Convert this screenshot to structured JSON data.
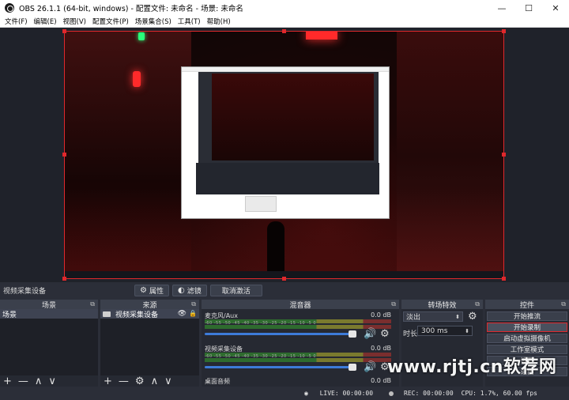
{
  "window": {
    "title": "OBS 26.1.1 (64-bit, windows) - 配置文件: 未命名 - 场景: 未命名",
    "minimize": "—",
    "maximize": "☐",
    "close": "✕"
  },
  "menu": [
    "文件(F)",
    "编辑(E)",
    "视图(V)",
    "配置文件(P)",
    "场景集合(S)",
    "工具(T)",
    "帮助(H)"
  ],
  "statusrow": {
    "source_name": "视频采集设备",
    "properties_label": "属性",
    "filters_label": "滤镜",
    "deactivate_label": "取消激活"
  },
  "scenes": {
    "header": "场景",
    "items": [
      "场景"
    ]
  },
  "sources": {
    "header": "来源",
    "items": [
      "视频采集设备"
    ]
  },
  "mixer": {
    "header": "混音器",
    "tracks": [
      {
        "name": "麦克风/Aux",
        "db": "0.0 dB"
      },
      {
        "name": "视频采集设备",
        "db": "0.0 dB"
      },
      {
        "name": "桌面音频",
        "db": "0.0 dB"
      }
    ],
    "ticks": "-60 -55 -50 -45 -40 -35 -30 -25 -20 -15 -10 -5 0"
  },
  "transitions": {
    "header": "转场特效",
    "selected": "淡出",
    "duration_label": "时长",
    "duration_value": "300 ms"
  },
  "controls": {
    "header": "控件",
    "buttons": [
      "开始推流",
      "开始录制",
      "启动虚拟摄像机",
      "工作室模式",
      "设置",
      "退出"
    ]
  },
  "status": {
    "live": "LIVE: 00:00:00",
    "rec": "REC: 00:00:00",
    "cpu": "CPU: 1.7%, 60.00 fps"
  },
  "watermark": "www.rjtj.cn软荐网",
  "colors": {
    "accent_red": "#e0282c",
    "slider_blue": "#3d7bd9",
    "panel": "#262932"
  },
  "icons": {
    "gear": "⚙",
    "plus": "+",
    "minus": "—",
    "up": "∧",
    "down": "∨",
    "eye": "👁",
    "lock": "🔒",
    "volume": "🔊",
    "pin": "⧉"
  }
}
